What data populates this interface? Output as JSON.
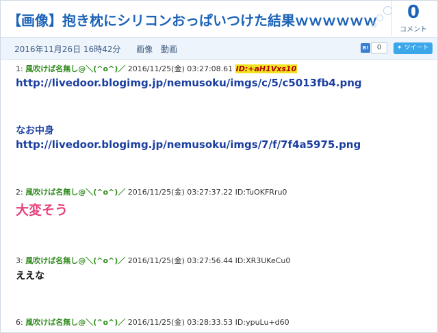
{
  "header": {
    "title": "【画像】抱き枕にシリコンおっぱいつけた結果ｗｗｗｗｗｗ",
    "comment_count": "0",
    "comment_label": "コメント"
  },
  "meta": {
    "date": "2016年11月26日 16時42分",
    "categories": [
      "画像",
      "動画"
    ],
    "hatena_label": "B!",
    "hatena_count": "0",
    "tweet_label": "ツイート"
  },
  "posts": [
    {
      "number": "1:",
      "name": "風吹けば名無し@＼(^o^)／",
      "datetime": "2016/11/25(金) 03:27:08.61",
      "id": "ID:+aH1Vxs10",
      "lines": [
        "http://livedoor.blogimg.jp/nemusoku/imgs/c/5/c5013fb4.png",
        "なお中身",
        "http://livedoor.blogimg.jp/nemusoku/imgs/7/f/7f4a5975.png"
      ]
    },
    {
      "number": "2:",
      "name": "風吹けば名無し@＼(^o^)／",
      "datetime": "2016/11/25(金) 03:27:37.22",
      "id": "ID:TuOKFRru0",
      "lines": [
        "大変そう"
      ]
    },
    {
      "number": "3:",
      "name": "風吹けば名無し@＼(^o^)／",
      "datetime": "2016/11/25(金) 03:27:56.44",
      "id": "ID:XR3UKeCu0",
      "lines": [
        "ええな"
      ]
    },
    {
      "number": "6:",
      "name": "風吹けば名無し@＼(^o^)／",
      "datetime": "2016/11/25(金) 03:28:33.53",
      "id": "ID:ypuLu+d60",
      "lines": []
    }
  ],
  "colors": {
    "title_blue": "#1d63b8",
    "name_green": "#2f8a1c",
    "link_blue": "#1b3fa0",
    "emphasis_pink": "#e8417d",
    "id_highlight": "#f3e21f"
  }
}
